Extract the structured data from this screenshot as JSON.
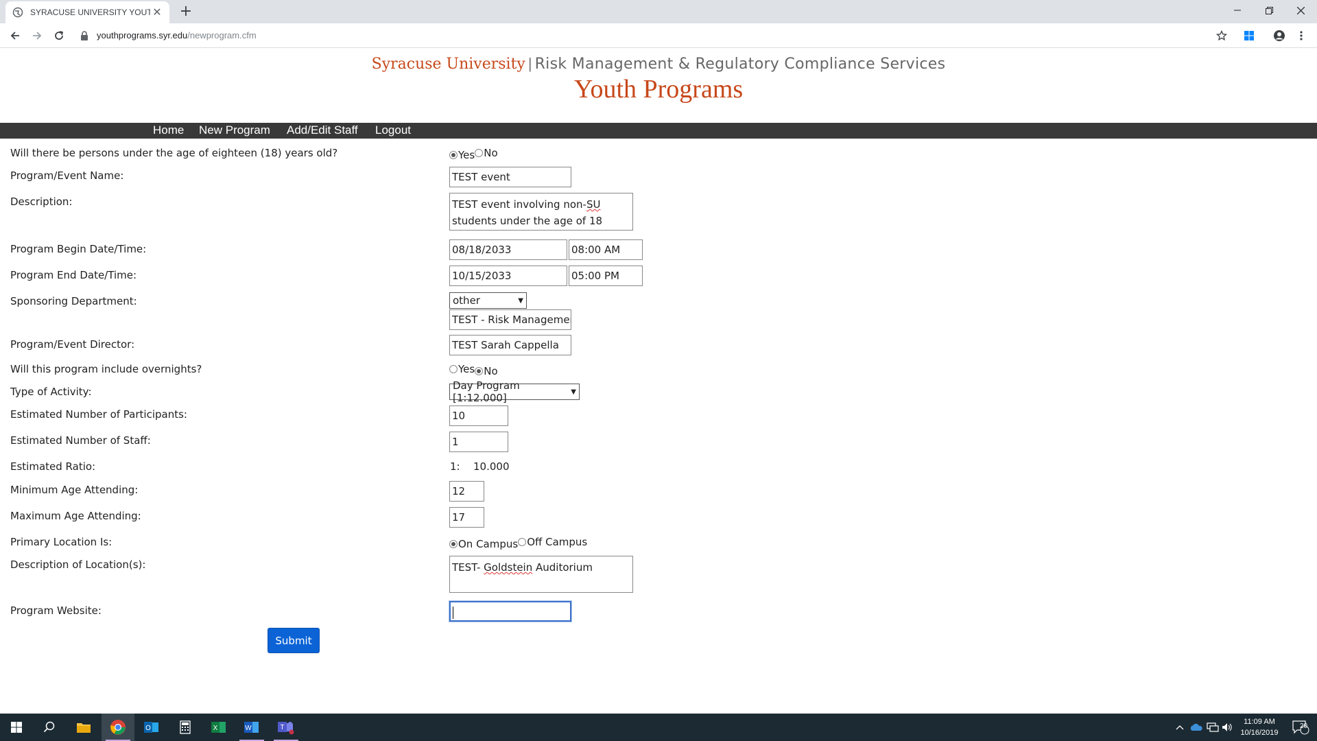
{
  "browser": {
    "tab_title": "SYRACUSE UNIVERSITY YOUTH P",
    "url_domain": "youthprograms.syr.edu",
    "url_path": "/newprogram.cfm"
  },
  "header": {
    "university": "Syracuse University",
    "separator": "|",
    "department": "Risk Management & Regulatory Compliance Services",
    "title": "Youth Programs"
  },
  "nav": {
    "items": [
      "Home",
      "New Program",
      "Add/Edit Staff",
      "Logout"
    ]
  },
  "form": {
    "under18": {
      "label": "Will there be persons under the age of eighteen (18) years old?",
      "opt_yes": "Yes",
      "opt_no": "No",
      "selected": "Yes"
    },
    "event_name": {
      "label": "Program/Event Name:",
      "value": "TEST event"
    },
    "description": {
      "label": "Description:",
      "line1_a": "TEST event involving non-",
      "line1_b": "SU",
      "line2": "students under the age of 18"
    },
    "begin": {
      "label": "Program Begin Date/Time:",
      "date": "08/18/2033",
      "time": "08:00 AM"
    },
    "end": {
      "label": "Program End Date/Time:",
      "date": "10/15/2033",
      "time": "05:00 PM"
    },
    "sponsor": {
      "label": "Sponsoring Department:",
      "selected": "other",
      "other_value": "TEST - Risk Management"
    },
    "director": {
      "label": "Program/Event Director:",
      "value": "TEST Sarah Cappella"
    },
    "overnights": {
      "label": "Will this program include overnights?",
      "opt_yes": "Yes",
      "opt_no": "No",
      "selected": "No"
    },
    "activity": {
      "label": "Type of Activity:",
      "selected": "Day Program [1:12.000]"
    },
    "participants": {
      "label": "Estimated Number of Participants:",
      "value": "10"
    },
    "staff": {
      "label": "Estimated Number of Staff:",
      "value": "1"
    },
    "ratio": {
      "label": "Estimated Ratio:",
      "prefix": "1:",
      "value": "10.000"
    },
    "min_age": {
      "label": "Minimum Age Attending:",
      "value": "12"
    },
    "max_age": {
      "label": "Maximum Age Attending:",
      "value": "17"
    },
    "location_type": {
      "label": "Primary Location Is:",
      "opt_on": "On Campus",
      "opt_off": "Off Campus",
      "selected": "On Campus"
    },
    "location_desc": {
      "label": "Description of Location(s):",
      "part_a": "TEST- ",
      "part_b": "Goldstein",
      "part_c": " Auditorium"
    },
    "website": {
      "label": "Program Website:",
      "value": ""
    },
    "submit_label": "Submit"
  },
  "taskbar": {
    "time": "11:09 AM",
    "date": "10/16/2019",
    "notifications": "20"
  }
}
